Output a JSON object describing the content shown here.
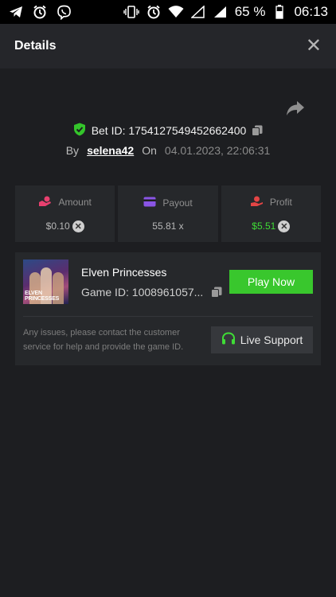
{
  "status_bar": {
    "battery": "65 %",
    "time": "06:13",
    "icons": [
      "telegram-icon",
      "alarm-icon",
      "viber-icon",
      "vibrate-icon",
      "alarm-icon",
      "wifi-icon",
      "signal-icon",
      "battery-icon"
    ]
  },
  "header": {
    "title": "Details",
    "close_glyph": "✕"
  },
  "bet": {
    "id_label": "Bet ID: 1754127549452662400",
    "by_label": "By",
    "user": "selena42",
    "on_label": "On",
    "date": "04.01.2023, 22:06:31"
  },
  "stats": {
    "amount": {
      "label": "Amount",
      "value": "$0.10"
    },
    "payout": {
      "label": "Payout",
      "value": "55.81 x"
    },
    "profit": {
      "label": "Profit",
      "value": "$5.51"
    }
  },
  "game": {
    "name": "Elven Princesses",
    "id_label": "Game ID: 1008961057...",
    "play_label": "Play Now",
    "thumb_caption_1": "ELVEN",
    "thumb_caption_2": "PRINCESSES"
  },
  "support": {
    "text": "Any issues, please contact the customer service for help and provide the game ID.",
    "button_label": "Live Support"
  },
  "colors": {
    "accent_green": "#39c72d",
    "profit_green": "#3fdc36",
    "amount_pink": "#e8406f",
    "payout_purple": "#8a55e6",
    "profit_red": "#e34545"
  }
}
